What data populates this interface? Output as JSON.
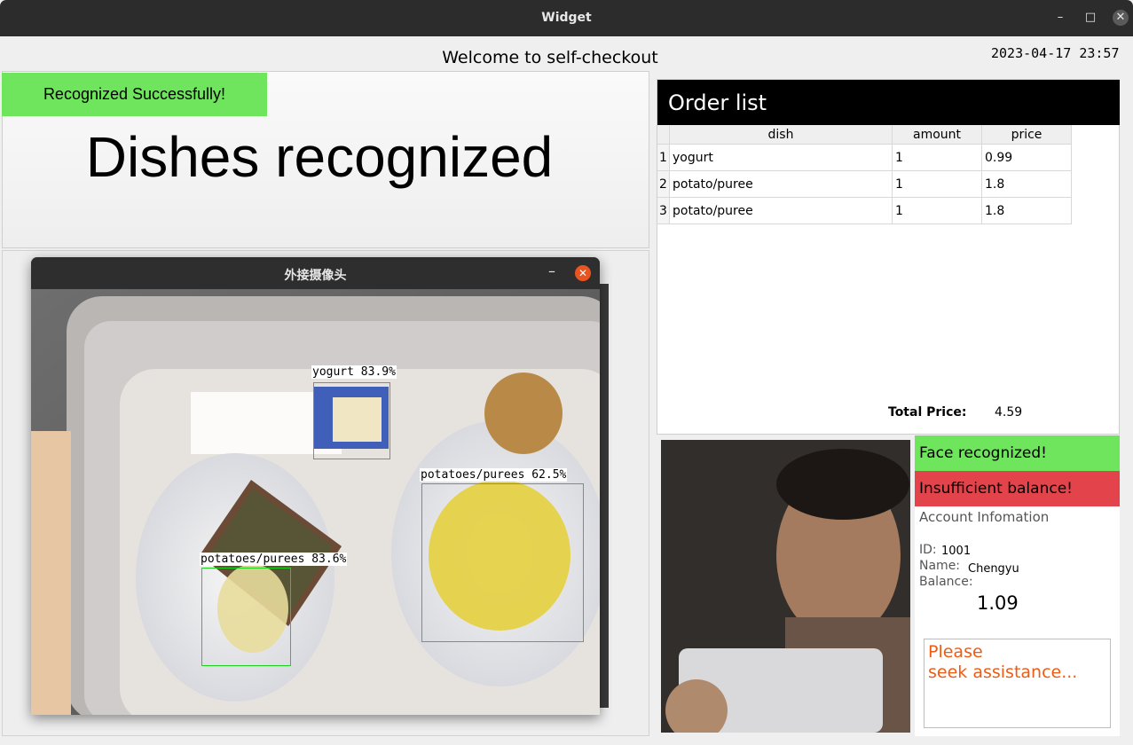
{
  "window": {
    "title": "Widget",
    "minimize": "–",
    "maximize": "□",
    "close": "✕"
  },
  "header": {
    "welcome": "Welcome to self-checkout",
    "datetime": "2023-04-17 23:57"
  },
  "recognition": {
    "status": "Recognized Successfully!",
    "heading": "Dishes recognized",
    "status_color": "#6ee55c"
  },
  "camera_window": {
    "title": "外接摄像头",
    "minimize": "–",
    "close": "✕",
    "detections": [
      {
        "label": "yogurt 83.9%"
      },
      {
        "label": "potatoes/purees 62.5%"
      },
      {
        "label": "potatoes/purees 83.6%"
      }
    ]
  },
  "order": {
    "title": "Order list",
    "columns": [
      "dish",
      "amount",
      "price"
    ],
    "rows": [
      {
        "n": "1",
        "dish": "yogurt",
        "amount": "1",
        "price": "0.99"
      },
      {
        "n": "2",
        "dish": "potato/puree",
        "amount": "1",
        "price": "1.8"
      },
      {
        "n": "3",
        "dish": "potato/puree",
        "amount": "1",
        "price": "1.8"
      }
    ],
    "total_label": "Total Price:",
    "total_value": "4.59"
  },
  "face": {
    "status": "Face recognized!",
    "balance_status": "Insufficient balance!",
    "account_heading": "Account Infomation",
    "id_label": "ID:",
    "id_value": "1001",
    "name_label": "Name:",
    "name_value": "Chengyu",
    "balance_label": "Balance:",
    "balance_value": "1.09",
    "assist": "Please\nseek assistance...",
    "ok_color": "#6ee55c",
    "warn_color": "#e3444c",
    "assist_color": "#ef5b13"
  }
}
